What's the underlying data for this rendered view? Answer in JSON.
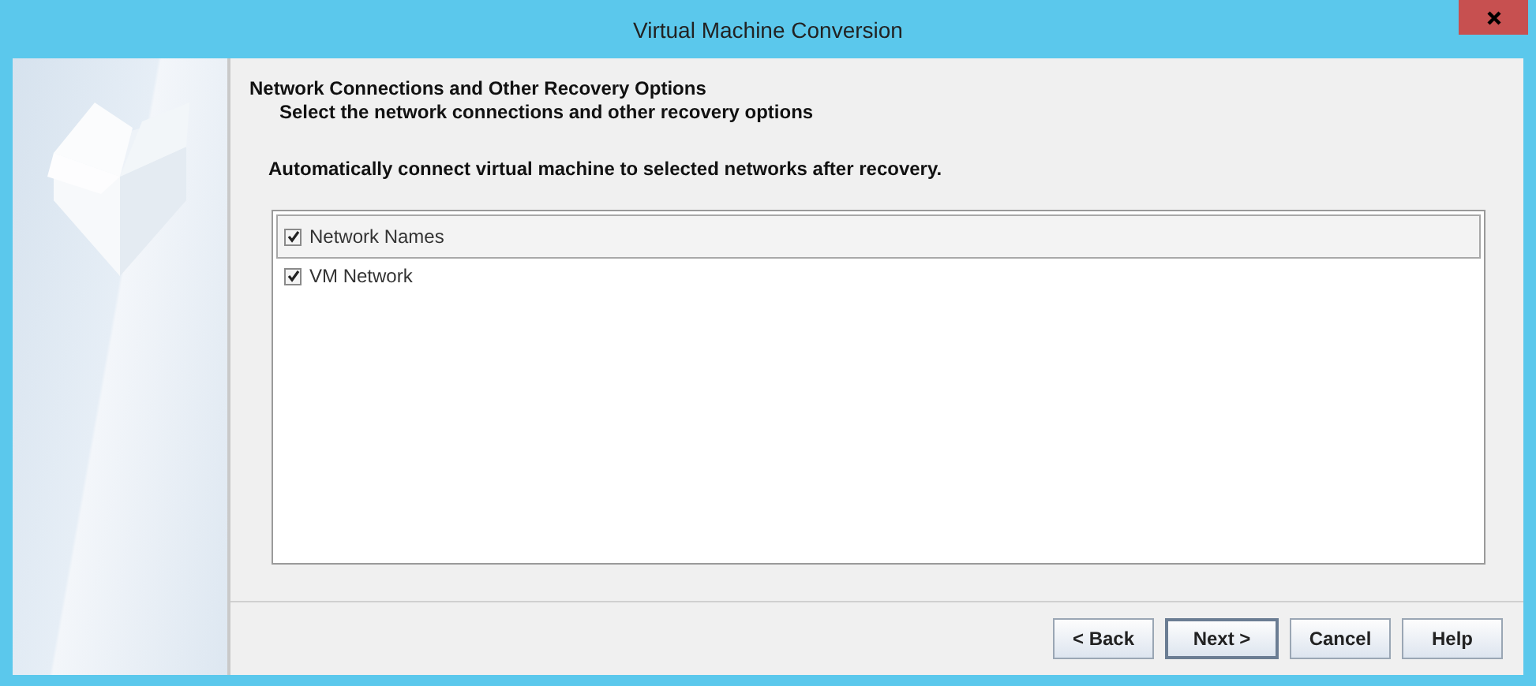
{
  "window": {
    "title": "Virtual Machine Conversion"
  },
  "page": {
    "heading": "Network Connections and Other Recovery Options",
    "subheading": "Select the network connections and other recovery options"
  },
  "instruction": "Automatically connect virtual machine to selected networks after recovery.",
  "network_table": {
    "header": {
      "label": "Network Names",
      "checked": true
    },
    "rows": [
      {
        "label": "VM Network",
        "checked": true
      }
    ]
  },
  "buttons": [
    {
      "label": "< Back",
      "default": false
    },
    {
      "label": "Next >",
      "default": true
    },
    {
      "label": "Cancel",
      "default": false
    },
    {
      "label": "Help",
      "default": false
    }
  ]
}
